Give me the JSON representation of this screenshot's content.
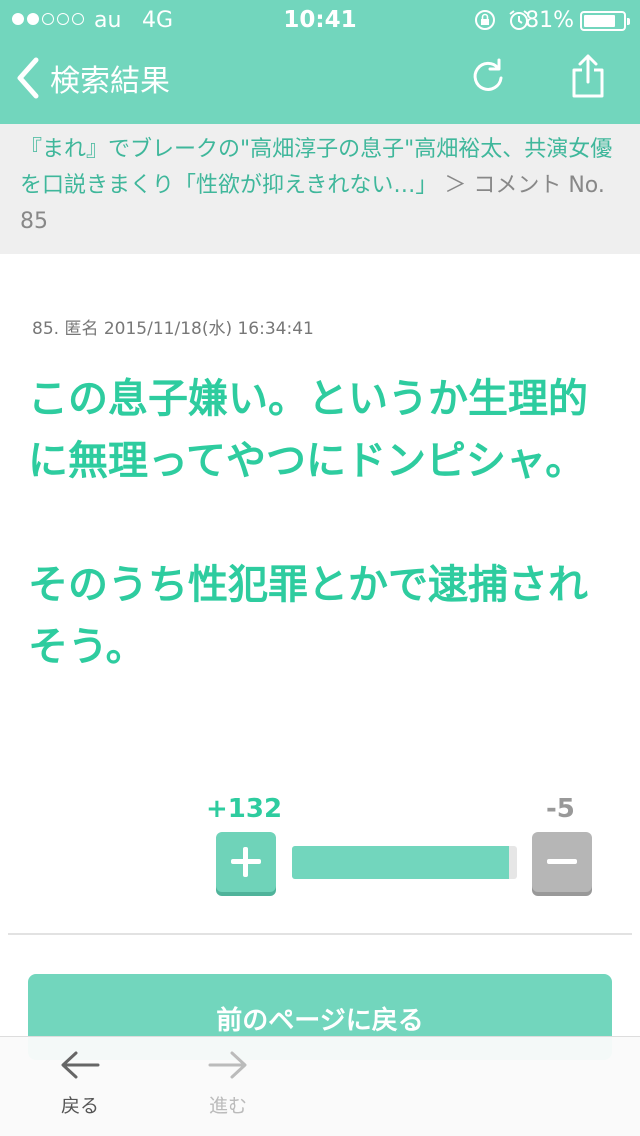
{
  "status_bar": {
    "carrier": "au",
    "network": "4G",
    "time": "10:41",
    "battery_percent": "81%",
    "battery_level": 0.81,
    "signal_strength": 2
  },
  "nav": {
    "back_label": "検索結果",
    "reload_icon": "reload-icon",
    "share_icon": "share-icon"
  },
  "breadcrumb": {
    "link": "『まれ』でブレークの\"高畑淳子の息子\"高畑裕太、共演女優を口説きまくり「性欲が抑えきれない…」",
    "separator": " ＞ ",
    "current": "コメント No. 85"
  },
  "comment": {
    "meta": "85. 匿名 2015/11/18(水) 16:34:41",
    "paragraphs": [
      "この息子嫌い。というか生理的に無理ってやつにドンピシャ。",
      "そのうち性犯罪とかで逮捕されそう。"
    ]
  },
  "votes": {
    "plus_label": "+132",
    "minus_label": "-5",
    "plus": 132,
    "minus": 5
  },
  "actions": {
    "back_page_label": "前のページに戻る"
  },
  "toolbar": {
    "back_label": "戻る",
    "forward_label": "進む"
  },
  "colors": {
    "accent": "#72d6bd",
    "text_accent": "#2ecc9f",
    "minus_gray": "#b6b6b6"
  }
}
